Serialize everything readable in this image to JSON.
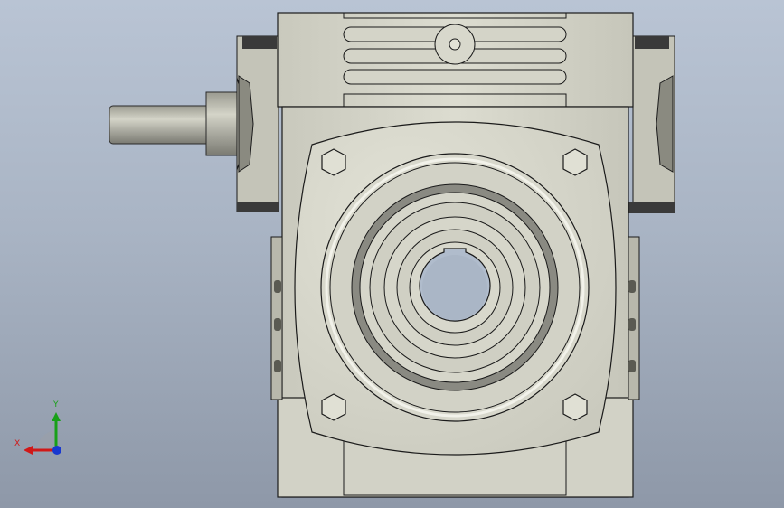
{
  "viewport": {
    "background_top": "#b9c4d4",
    "background_bottom": "#8e98a8",
    "model_fill": "#d6d6ca",
    "model_stroke": "#1a1a1a"
  },
  "triad": {
    "x_label": "X",
    "y_label": "Y",
    "x_color": "#d01818",
    "y_color": "#18a018",
    "z_color": "#1838d0"
  }
}
